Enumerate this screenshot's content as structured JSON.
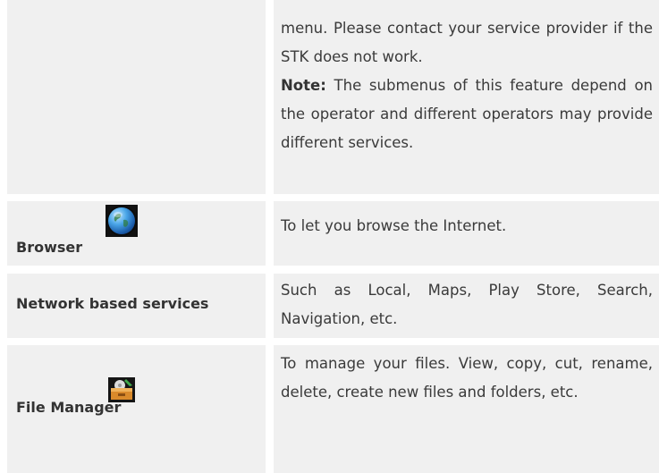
{
  "rows": [
    {
      "label": "",
      "description": {
        "line1": "menu. Please contact your service provider if the STK does not work.",
        "note_label": "Note:",
        "note_text": " The submenus of this feature depend on the operator and different operators may provide different services."
      }
    },
    {
      "label": "Browser",
      "icon": "globe-icon",
      "description": "To let you browse the Internet."
    },
    {
      "label": "Network based services",
      "description": "Such as Local, Maps, Play Store, Search, Navigation, etc."
    },
    {
      "label": "File Manager",
      "icon": "folder-icon",
      "description": "To manage your files. View, copy, cut, rename, delete, create new files and folders, etc."
    }
  ],
  "colors": {
    "cell_background": "#f0f0f0",
    "text": "#3a3a3a"
  }
}
